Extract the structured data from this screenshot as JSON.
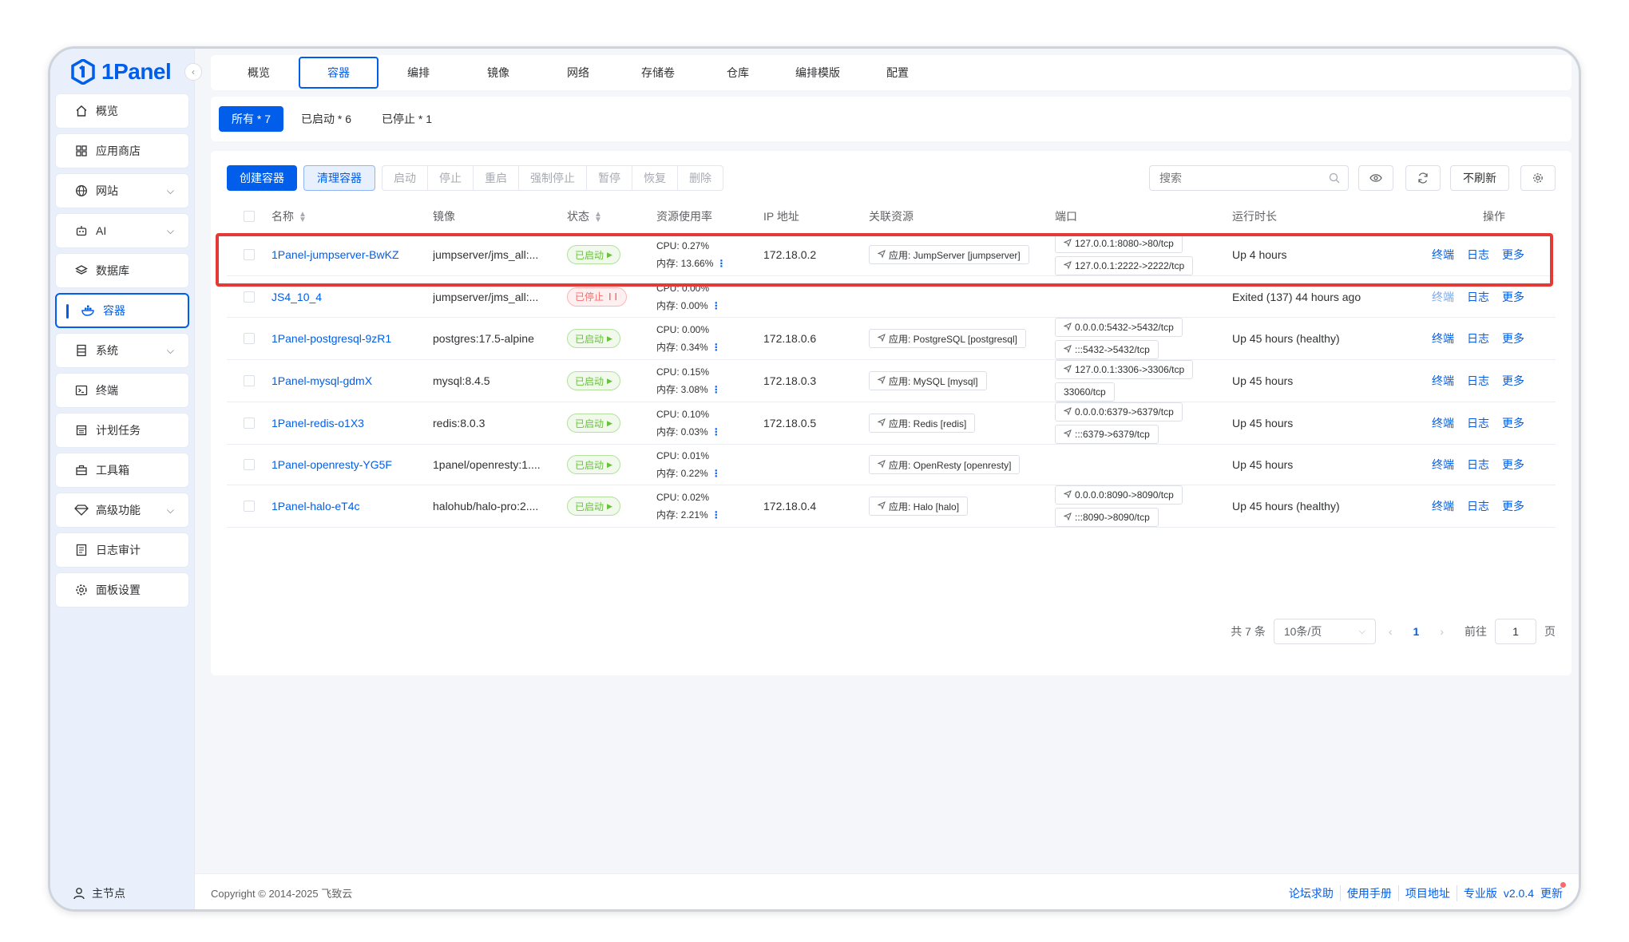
{
  "app": {
    "logo_text": "1Panel",
    "accent": "#005eeb"
  },
  "sidebar": {
    "items": [
      {
        "label": "概览",
        "icon": "home-icon",
        "has_chevron": false
      },
      {
        "label": "应用商店",
        "icon": "grid-icon",
        "has_chevron": false
      },
      {
        "label": "网站",
        "icon": "globe-icon",
        "has_chevron": true
      },
      {
        "label": "AI",
        "icon": "robot-icon",
        "has_chevron": true
      },
      {
        "label": "数据库",
        "icon": "layers-icon",
        "has_chevron": false
      },
      {
        "label": "容器",
        "icon": "docker-icon",
        "has_chevron": false,
        "active": true
      },
      {
        "label": "系统",
        "icon": "server-icon",
        "has_chevron": true
      },
      {
        "label": "终端",
        "icon": "terminal-icon",
        "has_chevron": false
      },
      {
        "label": "计划任务",
        "icon": "calendar-icon",
        "has_chevron": false
      },
      {
        "label": "工具箱",
        "icon": "toolbox-icon",
        "has_chevron": false
      },
      {
        "label": "高级功能",
        "icon": "diamond-icon",
        "has_chevron": true
      },
      {
        "label": "日志审计",
        "icon": "log-icon",
        "has_chevron": false
      },
      {
        "label": "面板设置",
        "icon": "gear-icon",
        "has_chevron": false
      }
    ],
    "footer_label": "主节点"
  },
  "top_tabs": [
    "概览",
    "容器",
    "编排",
    "镜像",
    "网络",
    "存储卷",
    "仓库",
    "编排模版",
    "配置"
  ],
  "active_top_tab": 1,
  "filters": [
    {
      "label": "所有 * 7",
      "active": true
    },
    {
      "label": "已启动 * 6",
      "active": false
    },
    {
      "label": "已停止 * 1",
      "active": false
    }
  ],
  "toolbar": {
    "create_label": "创建容器",
    "clean_label": "清理容器",
    "group_buttons": [
      "启动",
      "停止",
      "重启",
      "强制停止",
      "暂停",
      "恢复",
      "删除"
    ],
    "search_placeholder": "搜索",
    "refresh_label": "不刷新"
  },
  "table": {
    "headers": {
      "name": "名称",
      "image": "镜像",
      "state": "状态",
      "resource": "资源使用率",
      "ip": "IP 地址",
      "related": "关联资源",
      "ports": "端口",
      "uptime": "运行时长",
      "ops": "操作"
    },
    "ops_labels": {
      "terminal": "终端",
      "log": "日志",
      "more": "更多"
    },
    "rows": [
      {
        "name": "1Panel-jumpserver-BwKZ",
        "image": "jumpserver/jms_all:...",
        "state": "已启动",
        "running": true,
        "cpu": "CPU: 0.27%",
        "mem": "内存: 13.66%",
        "ip": "172.18.0.2",
        "related": "应用: JumpServer [jumpserver]",
        "ports": [
          "127.0.0.1:8080->80/tcp",
          "127.0.0.1:2222->2222/tcp"
        ],
        "port_icons": [
          true,
          true
        ],
        "uptime": "Up 4 hours"
      },
      {
        "name": "JS4_10_4",
        "image": "jumpserver/jms_all:...",
        "state": "已停止",
        "running": false,
        "cpu": "CPU: 0.00%",
        "mem": "内存: 0.00%",
        "ip": "",
        "related": "",
        "ports": [],
        "port_icons": [],
        "uptime": "Exited (137) 44 hours ago"
      },
      {
        "name": "1Panel-postgresql-9zR1",
        "image": "postgres:17.5-alpine",
        "state": "已启动",
        "running": true,
        "cpu": "CPU: 0.00%",
        "mem": "内存: 0.34%",
        "ip": "172.18.0.6",
        "related": "应用: PostgreSQL [postgresql]",
        "ports": [
          "0.0.0.0:5432->5432/tcp",
          ":::5432->5432/tcp"
        ],
        "port_icons": [
          true,
          true
        ],
        "uptime": "Up 45 hours (healthy)"
      },
      {
        "name": "1Panel-mysql-gdmX",
        "image": "mysql:8.4.5",
        "state": "已启动",
        "running": true,
        "cpu": "CPU: 0.15%",
        "mem": "内存: 3.08%",
        "ip": "172.18.0.3",
        "related": "应用: MySQL [mysql]",
        "ports": [
          "127.0.0.1:3306->3306/tcp",
          "33060/tcp"
        ],
        "port_icons": [
          true,
          false
        ],
        "uptime": "Up 45 hours"
      },
      {
        "name": "1Panel-redis-o1X3",
        "image": "redis:8.0.3",
        "state": "已启动",
        "running": true,
        "cpu": "CPU: 0.10%",
        "mem": "内存: 0.03%",
        "ip": "172.18.0.5",
        "related": "应用: Redis [redis]",
        "ports": [
          "0.0.0.0:6379->6379/tcp",
          ":::6379->6379/tcp"
        ],
        "port_icons": [
          true,
          true
        ],
        "uptime": "Up 45 hours"
      },
      {
        "name": "1Panel-openresty-YG5F",
        "image": "1panel/openresty:1....",
        "state": "已启动",
        "running": true,
        "cpu": "CPU: 0.01%",
        "mem": "内存: 0.22%",
        "ip": "",
        "related": "应用: OpenResty [openresty]",
        "ports": [],
        "port_icons": [],
        "uptime": "Up 45 hours"
      },
      {
        "name": "1Panel-halo-eT4c",
        "image": "halohub/halo-pro:2....",
        "state": "已启动",
        "running": true,
        "cpu": "CPU: 0.02%",
        "mem": "内存: 2.21%",
        "ip": "172.18.0.4",
        "related": "应用: Halo [halo]",
        "ports": [
          "0.0.0.0:8090->8090/tcp",
          ":::8090->8090/tcp"
        ],
        "port_icons": [
          true,
          true
        ],
        "uptime": "Up 45 hours (healthy)"
      }
    ]
  },
  "pagination": {
    "total": "共 7 条",
    "page_size": "10条/页",
    "current": "1",
    "goto_label": "前往",
    "goto_value": "1",
    "page_suffix": "页"
  },
  "footer": {
    "copyright": "Copyright © 2014-2025 飞致云",
    "links": [
      "论坛求助",
      "使用手册",
      "项目地址",
      "专业版"
    ],
    "version": "v2.0.4",
    "update": "更新"
  }
}
